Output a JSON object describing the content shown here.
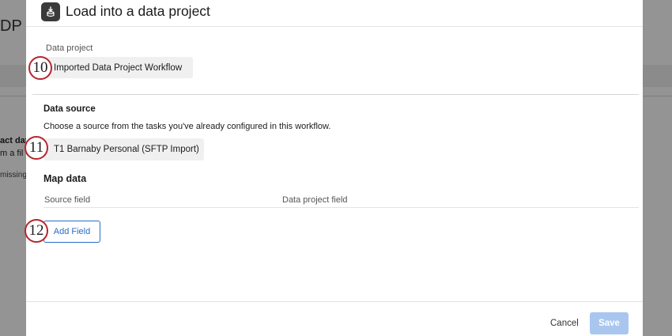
{
  "background": {
    "title_fragment": "DP I",
    "text_fragment_1": "act dat",
    "text_fragment_2": "m a fil",
    "text_fragment_3": "missing"
  },
  "modal": {
    "title": "Load into a data project",
    "header_icon": "data-load-icon",
    "data_project": {
      "label": "Data project",
      "selected_value": "Imported Data Project Workflow"
    },
    "data_source": {
      "heading": "Data source",
      "help_text": "Choose a source from the tasks you've already configured in this workflow.",
      "selected_value": "T1 Barnaby Personal (SFTP Import)"
    },
    "map_data": {
      "heading": "Map data",
      "columns": [
        "Source field",
        "Data project field"
      ],
      "add_field_label": "Add Field"
    },
    "footer": {
      "cancel_label": "Cancel",
      "save_label": "Save"
    }
  },
  "callouts": [
    "10",
    "11",
    "12"
  ],
  "colors": {
    "callout_ring": "#b5262e",
    "primary_blue": "#2b6cc4",
    "save_disabled": "#a9c6ef"
  }
}
